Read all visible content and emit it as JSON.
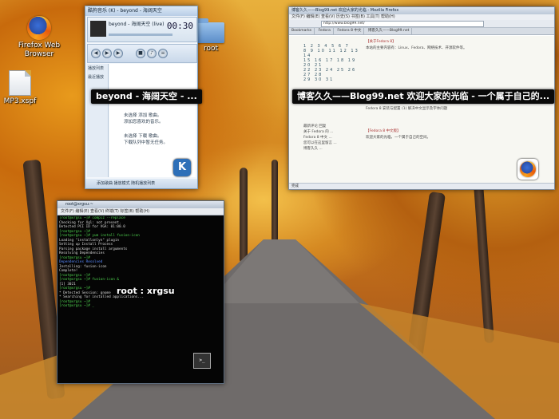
{
  "desktop": {
    "icons": [
      {
        "label": "Firefox Web Browser",
        "icon": "firefox-icon"
      },
      {
        "label": "MP3.xspf",
        "icon": "file-icon"
      },
      {
        "label": "root",
        "icon": "folder-icon"
      }
    ]
  },
  "player": {
    "title": "酷狗音乐 (K) - beyond - 海阔天空",
    "track": "beyond - 海阔天空 (live)",
    "time": "00:30",
    "sidebar": [
      "播放列表",
      "最近播放"
    ],
    "list_lines": [
      "未选择 添加 歌曲。",
      "添加您喜欢的音乐。",
      "未选择 下载 歌曲。",
      "下载队列中暂无任务。"
    ],
    "bottom": "添加歌曲  播放模式  随机播放列表",
    "caption": "beyond - 海阔天空 - ...",
    "badge": "K"
  },
  "browser": {
    "title": "博客久久——Blog99.net 欢迎大家的光临 - Mozilla Firefox",
    "menubar": "文件(F) 编辑(E) 查看(V) 历史(S) 书签(B) 工具(T) 帮助(H)",
    "url": "http://www.blog99.net/",
    "tabs": [
      "Bookmarks",
      "Fedora",
      "Fedora 8 中文",
      "博客久久——Blog99.net"
    ],
    "calendar": [
      "1 2 3 4 5 6 7",
      "8 9 10 11 12 13 14",
      "15 16 17 18 19 20 21",
      "22 23 24 25 26 27 28",
      "29 30 31"
    ],
    "side_text": [
      "最新评论 回复",
      "关于 Fedora 的 ...",
      "Fedora 8 中文 ...",
      "您可以在这里留言 ...",
      "博客久久 ..."
    ],
    "main_text": [
      "【关于Fedora 8】",
      "本站的主要内容有：Linux、Fedora、网络技术、开源软件等。",
      "【Fedora 8 使用心得】",
      "Fedora 8 安装与配置 (1)   解决中文显示及字体问题",
      "【Fedora 8 中文版】",
      "欢迎大家的光临，一个属于自己的空间。"
    ],
    "status": "完成",
    "caption": "博客久久——Blog99.net 欢迎大家的光临 - 一个属于自己的..."
  },
  "terminal": {
    "title": "root@xrgsu:~",
    "menubar": "文件(F)  编辑(E)  查看(V)  终端(T)  标签(B)  帮助(H)",
    "caption": "root : xrgsu",
    "icon_glyph": ">_",
    "lines": [
      {
        "cls": "",
        "text": "[root@xrgsu ~]# compiz --replace"
      },
      {
        "cls": "w",
        "text": "Checking for Xgl: not present."
      },
      {
        "cls": "w",
        "text": "Detected PCI ID for VGA: 01:00.0"
      },
      {
        "cls": "",
        "text": "[root@xrgsu ~]#"
      },
      {
        "cls": "",
        "text": "[root@xrgsu ~]# yum install fusion-icon"
      },
      {
        "cls": "w",
        "text": "Loading \"installonlyn\" plugin"
      },
      {
        "cls": "w",
        "text": "Setting up Install Process"
      },
      {
        "cls": "w",
        "text": "Parsing package install arguments"
      },
      {
        "cls": "w",
        "text": "Resolving Dependencies"
      },
      {
        "cls": "",
        "text": "[root@xrgsu ~]#"
      },
      {
        "cls": "b",
        "text": "Dependencies Resolved"
      },
      {
        "cls": "w",
        "text": "Installing: fusion-icon"
      },
      {
        "cls": "w",
        "text": "Complete!"
      },
      {
        "cls": "",
        "text": "[root@xrgsu ~]#"
      },
      {
        "cls": "",
        "text": "[root@xrgsu ~]# fusion-icon &"
      },
      {
        "cls": "w",
        "text": "[1] 3021"
      },
      {
        "cls": "",
        "text": "[root@xrgsu ~]#"
      },
      {
        "cls": "w",
        "text": "* Detected Session: gnome"
      },
      {
        "cls": "w",
        "text": "* Searching for installed applications..."
      },
      {
        "cls": "",
        "text": "[root@xrgsu ~]#"
      },
      {
        "cls": "",
        "text": "[root@xrgsu ~]# _"
      }
    ]
  }
}
